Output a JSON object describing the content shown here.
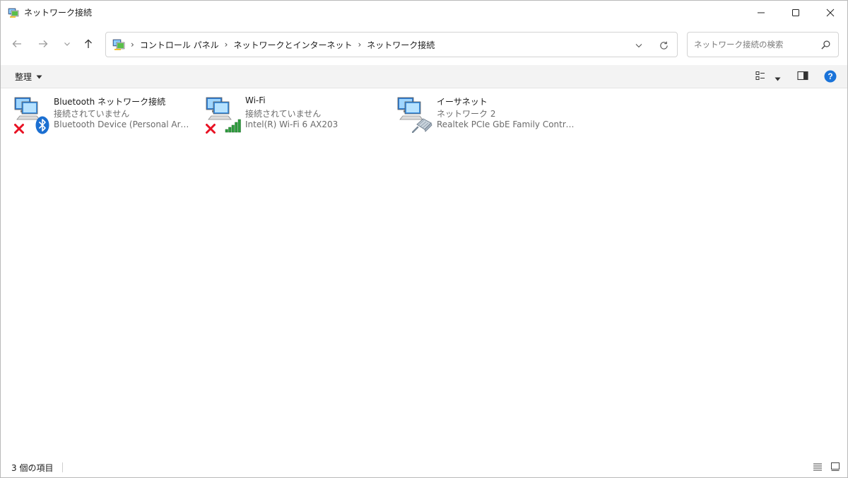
{
  "window": {
    "title": "ネットワーク接続"
  },
  "breadcrumb": {
    "items": [
      "コントロール パネル",
      "ネットワークとインターネット",
      "ネットワーク接続"
    ],
    "separator": "›"
  },
  "search": {
    "placeholder": "ネットワーク接続の検索"
  },
  "toolbar": {
    "organize_label": "整理"
  },
  "connections": [
    {
      "name": "Bluetooth ネットワーク接続",
      "status": "接続されていません",
      "device": "Bluetooth Device (Personal Area Network)",
      "badge_icon": "bluetooth-icon",
      "state_icon": "disconnected-x-icon"
    },
    {
      "name": "Wi-Fi",
      "status": "接続されていません",
      "device": "Intel(R) Wi-Fi 6 AX203",
      "badge_icon": "wifi-signal-icon",
      "state_icon": "disconnected-x-icon"
    },
    {
      "name": "イーサネット",
      "status": "ネットワーク 2",
      "device": "Realtek PCIe GbE Family Controller",
      "badge_icon": "ethernet-cable-icon",
      "state_icon": ""
    }
  ],
  "statusbar": {
    "item_count": "3 個の項目"
  },
  "colors": {
    "accent": "#0067c0",
    "commandbar_bg": "#f3f3f3",
    "error_red": "#e81123",
    "signal_green": "#2e9e3e",
    "bluetooth_blue": "#1b6fd1"
  }
}
